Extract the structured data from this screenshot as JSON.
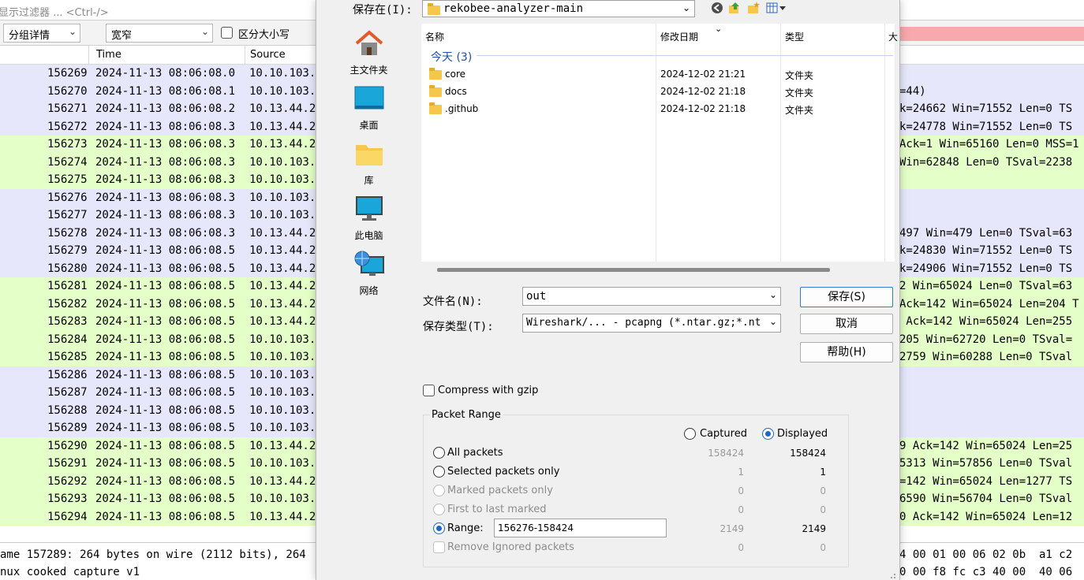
{
  "background": {
    "filter_placeholder": "显示过滤器 ... <Ctrl-/>",
    "toolbar": {
      "dropdown1": "分组详情",
      "dropdown2": "宽窄",
      "case_label": "区分大小写"
    },
    "columns": [
      "Time",
      "Source"
    ],
    "packets": [
      {
        "no": "156269",
        "time": "2024-11-13 08:06:08.0",
        "src": "10.10.103.",
        "info": "",
        "color": "lav"
      },
      {
        "no": "156270",
        "time": "2024-11-13 08:06:08.1",
        "src": "10.10.103.",
        "info": "=44)",
        "color": "lav"
      },
      {
        "no": "156271",
        "time": "2024-11-13 08:06:08.2",
        "src": "10.13.44.2",
        "info": "k=24662 Win=71552 Len=0 TS",
        "color": "lav"
      },
      {
        "no": "156272",
        "time": "2024-11-13 08:06:08.3",
        "src": "10.13.44.2",
        "info": "k=24778 Win=71552 Len=0 TS",
        "color": "lav"
      },
      {
        "no": "156273",
        "time": "2024-11-13 08:06:08.3",
        "src": "10.13.44.2",
        "info": "Ack=1 Win=65160 Len=0 MSS=1",
        "color": "grn"
      },
      {
        "no": "156274",
        "time": "2024-11-13 08:06:08.3",
        "src": "10.10.103.",
        "info": "Win=62848 Len=0 TSval=2238",
        "color": "grn"
      },
      {
        "no": "156275",
        "time": "2024-11-13 08:06:08.3",
        "src": "10.10.103.",
        "info": "",
        "color": "grn"
      },
      {
        "no": "156276",
        "time": "2024-11-13 08:06:08.3",
        "src": "10.10.103.",
        "info": "",
        "color": "lav"
      },
      {
        "no": "156277",
        "time": "2024-11-13 08:06:08.3",
        "src": "10.10.103.",
        "info": "",
        "color": "lav"
      },
      {
        "no": "156278",
        "time": "2024-11-13 08:06:08.3",
        "src": "10.13.44.2",
        "info": "497 Win=479 Len=0 TSval=63",
        "color": "lav"
      },
      {
        "no": "156279",
        "time": "2024-11-13 08:06:08.5",
        "src": "10.13.44.2",
        "info": "k=24830 Win=71552 Len=0 TS",
        "color": "lav"
      },
      {
        "no": "156280",
        "time": "2024-11-13 08:06:08.5",
        "src": "10.13.44.2",
        "info": "k=24906 Win=71552 Len=0 TS",
        "color": "lav"
      },
      {
        "no": "156281",
        "time": "2024-11-13 08:06:08.5",
        "src": "10.13.44.2",
        "info": "2 Win=65024 Len=0 TSval=63",
        "color": "grn"
      },
      {
        "no": "156282",
        "time": "2024-11-13 08:06:08.5",
        "src": "10.13.44.2",
        "info": "Ack=142 Win=65024 Len=204 T",
        "color": "grn"
      },
      {
        "no": "156283",
        "time": "2024-11-13 08:06:08.5",
        "src": "10.13.44.2",
        "info": " Ack=142 Win=65024 Len=255",
        "color": "grn"
      },
      {
        "no": "156284",
        "time": "2024-11-13 08:06:08.5",
        "src": "10.10.103.",
        "info": "205 Win=62720 Len=0 TSval=",
        "color": "grn"
      },
      {
        "no": "156285",
        "time": "2024-11-13 08:06:08.5",
        "src": "10.10.103.",
        "info": "2759 Win=60288 Len=0 TSval",
        "color": "grn"
      },
      {
        "no": "156286",
        "time": "2024-11-13 08:06:08.5",
        "src": "10.10.103.",
        "info": "",
        "color": "lav"
      },
      {
        "no": "156287",
        "time": "2024-11-13 08:06:08.5",
        "src": "10.10.103.",
        "info": "",
        "color": "lav"
      },
      {
        "no": "156288",
        "time": "2024-11-13 08:06:08.5",
        "src": "10.10.103.",
        "info": "",
        "color": "lav"
      },
      {
        "no": "156289",
        "time": "2024-11-13 08:06:08.5",
        "src": "10.10.103.",
        "info": "",
        "color": "lav"
      },
      {
        "no": "156290",
        "time": "2024-11-13 08:06:08.5",
        "src": "10.13.44.2",
        "info": "9 Ack=142 Win=65024 Len=25",
        "color": "grn"
      },
      {
        "no": "156291",
        "time": "2024-11-13 08:06:08.5",
        "src": "10.10.103.",
        "info": "5313 Win=57856 Len=0 TSval",
        "color": "grn"
      },
      {
        "no": "156292",
        "time": "2024-11-13 08:06:08.5",
        "src": "10.13.44.2",
        "info": "=142 Win=65024 Len=1277 TS",
        "color": "grn"
      },
      {
        "no": "156293",
        "time": "2024-11-13 08:06:08.5",
        "src": "10.10.103.",
        "info": "6590 Win=56704 Len=0 TSval",
        "color": "grn"
      },
      {
        "no": "156294",
        "time": "2024-11-13 08:06:08.5",
        "src": "10.13.44.2",
        "info": "0 Ack=142 Win=65024 Len=12",
        "color": "grn"
      }
    ],
    "detail_line1": "ame 157289: 264 bytes on wire (2112 bits), 264",
    "detail_line2": "nux cooked capture v1",
    "hex_line1": "4 00 01 00 06 02 0b  a1 c2",
    "hex_line2": "0 00 f8 fc c3 40 00  40 06"
  },
  "dialog": {
    "lookin_label": "保存在(I):",
    "lookin_value": "rekobee-analyzer-main",
    "places": [
      "主文件夹",
      "桌面",
      "库",
      "此电脑",
      "网络"
    ],
    "list_columns": [
      "名称",
      "修改日期",
      "类型",
      "大"
    ],
    "group_header": "今天 (3)",
    "files": [
      {
        "name": "core",
        "date": "2024-12-02 21:21",
        "type": "文件夹"
      },
      {
        "name": "docs",
        "date": "2024-12-02 21:18",
        "type": "文件夹"
      },
      {
        "name": ".github",
        "date": "2024-12-02 21:18",
        "type": "文件夹"
      }
    ],
    "filename_label": "文件名(N):",
    "filename_value": "out",
    "filetype_label": "保存类型(T):",
    "filetype_value": "Wireshark/... - pcapng (*.ntar.gz;*.nt",
    "buttons": {
      "save": "保存(S)",
      "cancel": "取消",
      "help": "帮助(H)"
    },
    "compress_label": "Compress with gzip",
    "packet_range": {
      "title": "Packet Range",
      "captured_label": "Captured",
      "displayed_label": "Displayed",
      "rows": [
        {
          "label": "All packets",
          "captured": "158424",
          "displayed": "158424"
        },
        {
          "label": "Selected packets only",
          "captured": "1",
          "displayed": "1"
        },
        {
          "label": "Marked packets only",
          "captured": "0",
          "displayed": "0"
        },
        {
          "label": "First to last marked",
          "captured": "0",
          "displayed": "0"
        },
        {
          "label": "Range:",
          "captured": "2149",
          "displayed": "2149"
        },
        {
          "label": "Remove Ignored packets",
          "captured": "0",
          "displayed": "0"
        }
      ],
      "range_value": "156276-158424"
    }
  }
}
